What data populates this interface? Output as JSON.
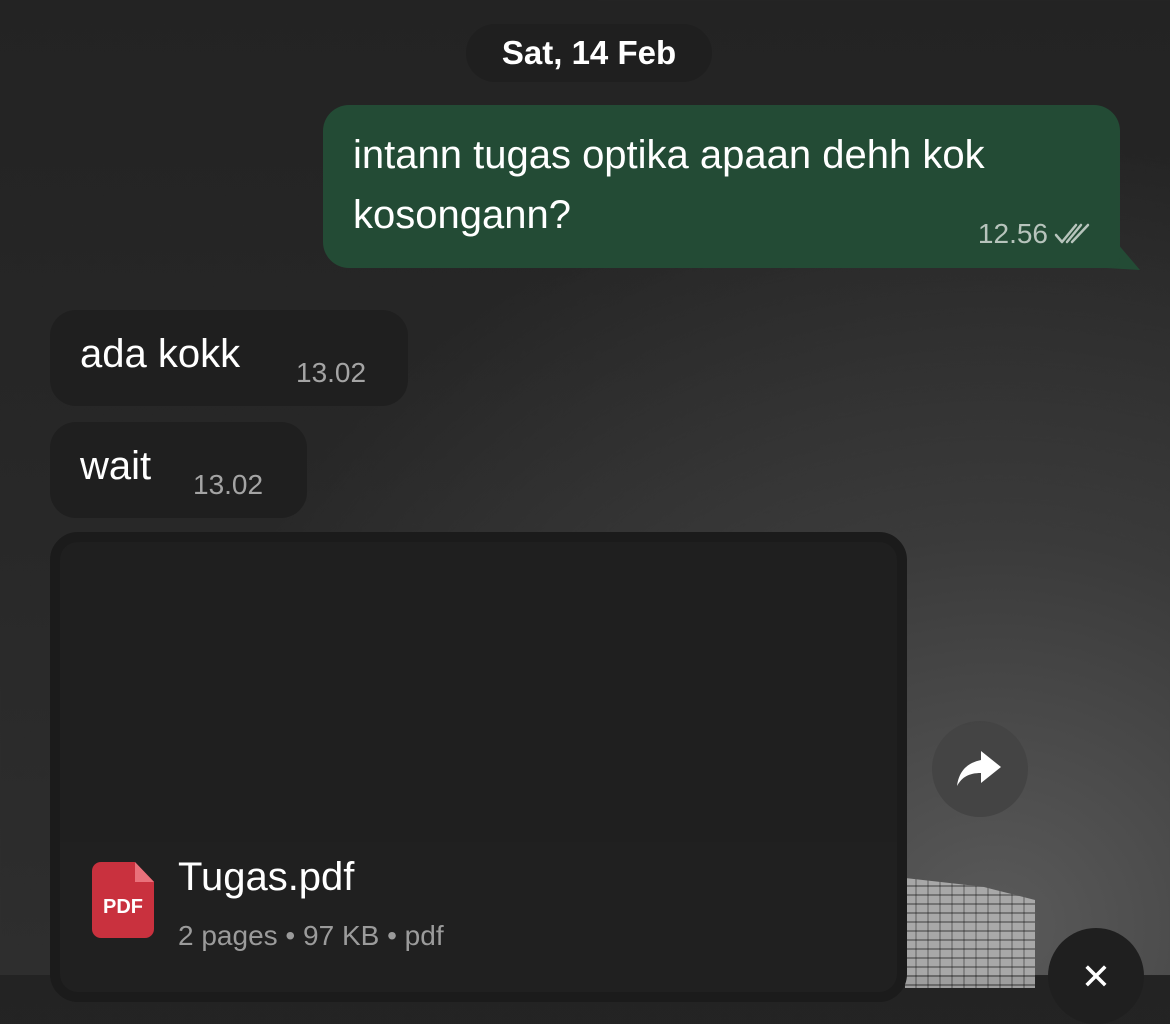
{
  "chat": {
    "date_divider": "Sat, 14 Feb",
    "outgoing_message": {
      "line_1": "intann tugas optika apaan dehh kok",
      "line_2": "kosongann?",
      "time": "12.56",
      "status_icon": "double-check-icon"
    },
    "incoming_messages": [
      {
        "text": "ada kokk",
        "time": "13.02"
      },
      {
        "text": "wait",
        "time": "13.02"
      }
    ],
    "file_attachment": {
      "icon_label": "PDF",
      "file_name": "Tugas.pdf",
      "pages": "2 pages",
      "separator": "•",
      "size": "97 KB",
      "type": "pdf"
    },
    "actions": {
      "forward_icon": "forward-arrow-icon",
      "close_icon": "close-icon"
    }
  },
  "colors": {
    "outgoing_bubble": "#234b35",
    "incoming_bubble": "#1f1f1f",
    "pdf_red": "#c9313e"
  }
}
